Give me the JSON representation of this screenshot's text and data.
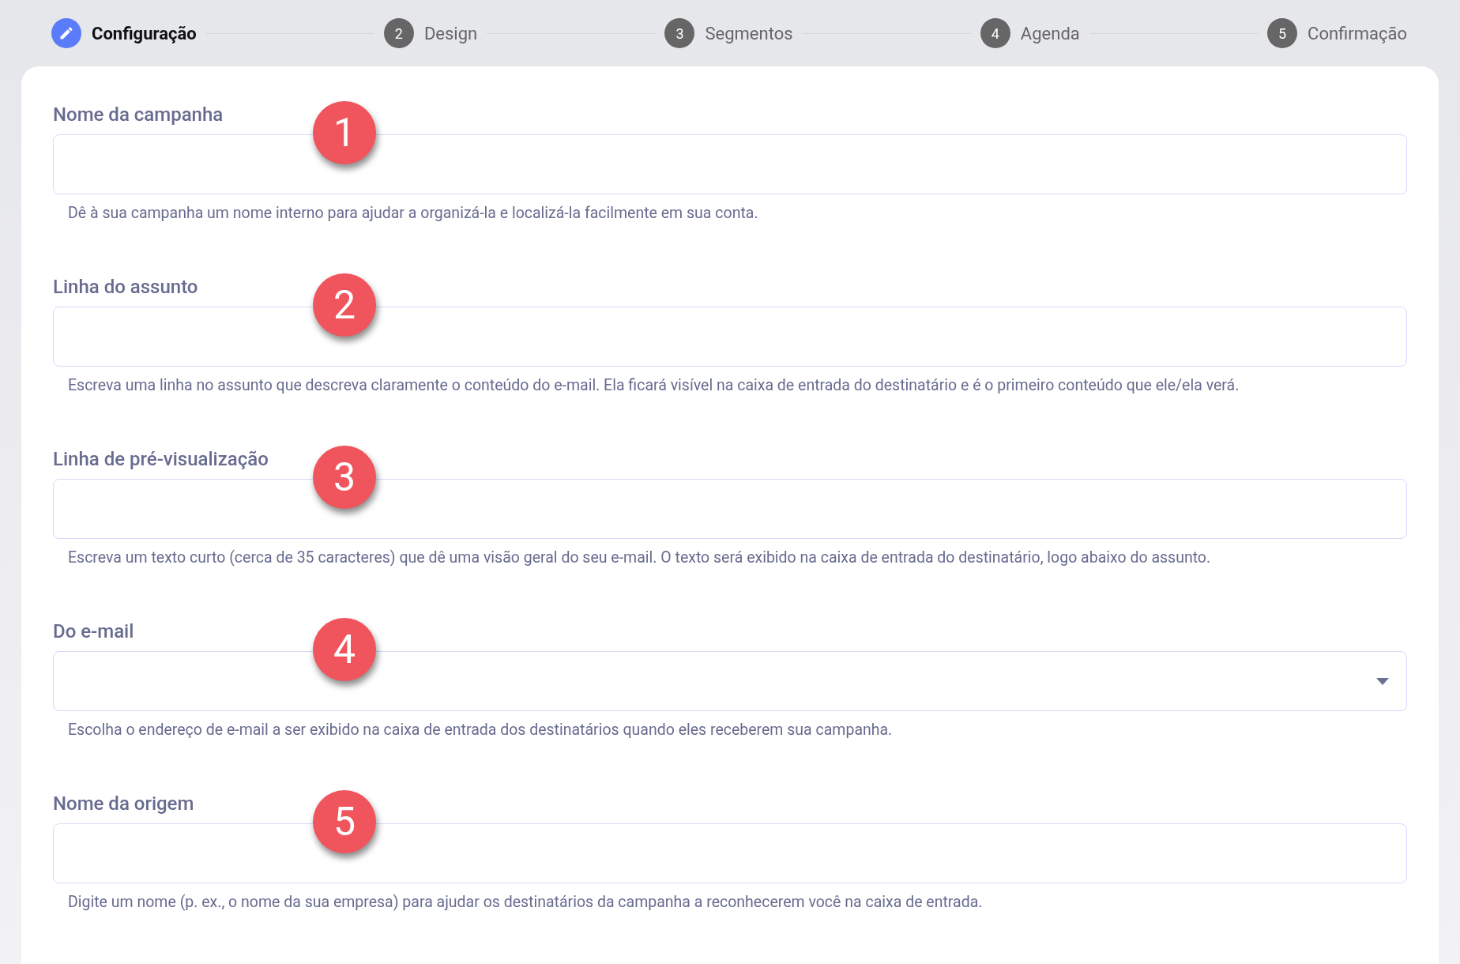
{
  "steps": [
    {
      "label": "Configuração",
      "selected": true
    },
    {
      "number": "2",
      "label": "Design",
      "selected": false
    },
    {
      "number": "3",
      "label": "Segmentos",
      "selected": false
    },
    {
      "number": "4",
      "label": "Agenda",
      "selected": false
    },
    {
      "number": "5",
      "label": "Confirmação",
      "selected": false
    }
  ],
  "fields": [
    {
      "kind": "text",
      "label": "Nome da campanha",
      "callout": "1",
      "help": "Dê à sua campanha um nome interno para ajudar a organizá-la e localizá-la facilmente em sua conta."
    },
    {
      "kind": "text",
      "label": "Linha do assunto",
      "callout": "2",
      "help": "Escreva uma linha no assunto que descreva claramente o conteúdo do e-mail. Ela ficará visível na caixa de entrada do destinatário e é o primeiro conteúdo que ele/ela verá."
    },
    {
      "kind": "text",
      "label": "Linha de pré-visualização",
      "callout": "3",
      "help": "Escreva um texto curto (cerca de 35 caracteres) que dê uma visão geral do seu e-mail. O texto será exibido na caixa de entrada do destinatário, logo abaixo do assunto."
    },
    {
      "kind": "select",
      "label": "Do e-mail",
      "callout": "4",
      "help": "Escolha o endereço de e-mail a ser exibido na caixa de entrada dos destinatários quando eles receberem sua campanha."
    },
    {
      "kind": "text",
      "label": "Nome da origem",
      "callout": "5",
      "help": "Digite um nome (p. ex., o nome da sua empresa) para ajudar os destinatários da campanha a reconhecerem você na caixa de entrada."
    }
  ]
}
